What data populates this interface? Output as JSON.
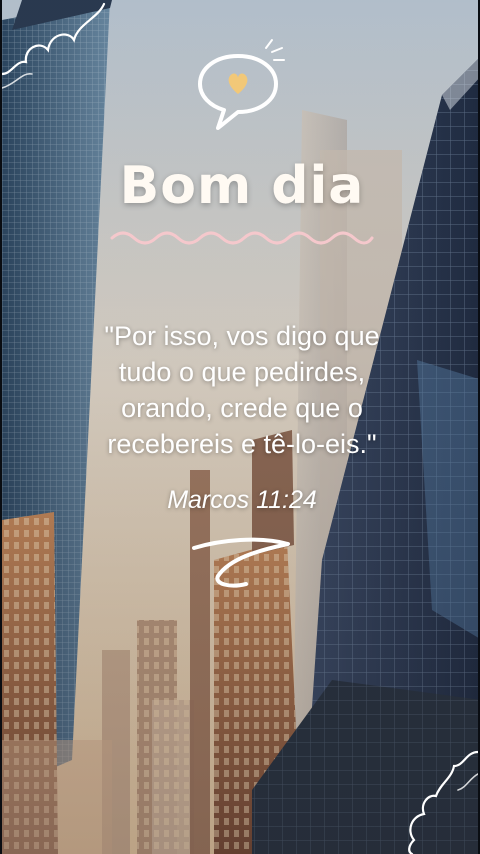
{
  "greeting": "Bom dia",
  "quote": "\"Por isso, vos digo que\ntudo o que pedirdes,\norando, crede que o\nrecebereis e tê-lo-eis.\"",
  "reference": "Marcos 11:24",
  "icons": {
    "speech_bubble": "heart-speech-bubble-icon",
    "wave": "wave-underline",
    "squiggle": "scribble-doodle",
    "cloud_top_left": "cloud-doodle",
    "cloud_bottom_right": "cloud-doodle"
  },
  "colors": {
    "text": "#ffffff",
    "heart": "#f2c878",
    "wave": "#f5c8cc"
  }
}
